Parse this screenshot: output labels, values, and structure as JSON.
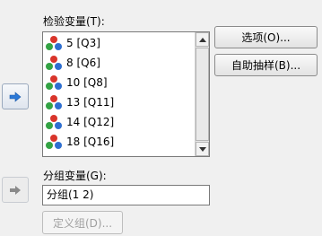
{
  "test_variables": {
    "label": "检验变量(T):",
    "items": [
      {
        "label": "5 [Q3]"
      },
      {
        "label": "8 [Q6]"
      },
      {
        "label": "10 [Q8]"
      },
      {
        "label": "13 [Q11]"
      },
      {
        "label": "14 [Q12]"
      },
      {
        "label": "18 [Q16]"
      }
    ]
  },
  "buttons": {
    "options_label": "选项(O)...",
    "bootstrap_label": "自助抽样(B)..."
  },
  "grouping": {
    "label": "分组变量(G):",
    "value": "分组(1 2)",
    "define_label": "定义组(D)..."
  },
  "colors": {
    "arrow": "#2b78d7",
    "arrow_disabled": "#8a8a8a",
    "icon_red": "#d9352b",
    "icon_green": "#33a344",
    "icon_blue": "#2f6fd0"
  },
  "icons": {
    "move_arrow": "right-arrow-icon",
    "variable": "scale-variable-icon"
  }
}
